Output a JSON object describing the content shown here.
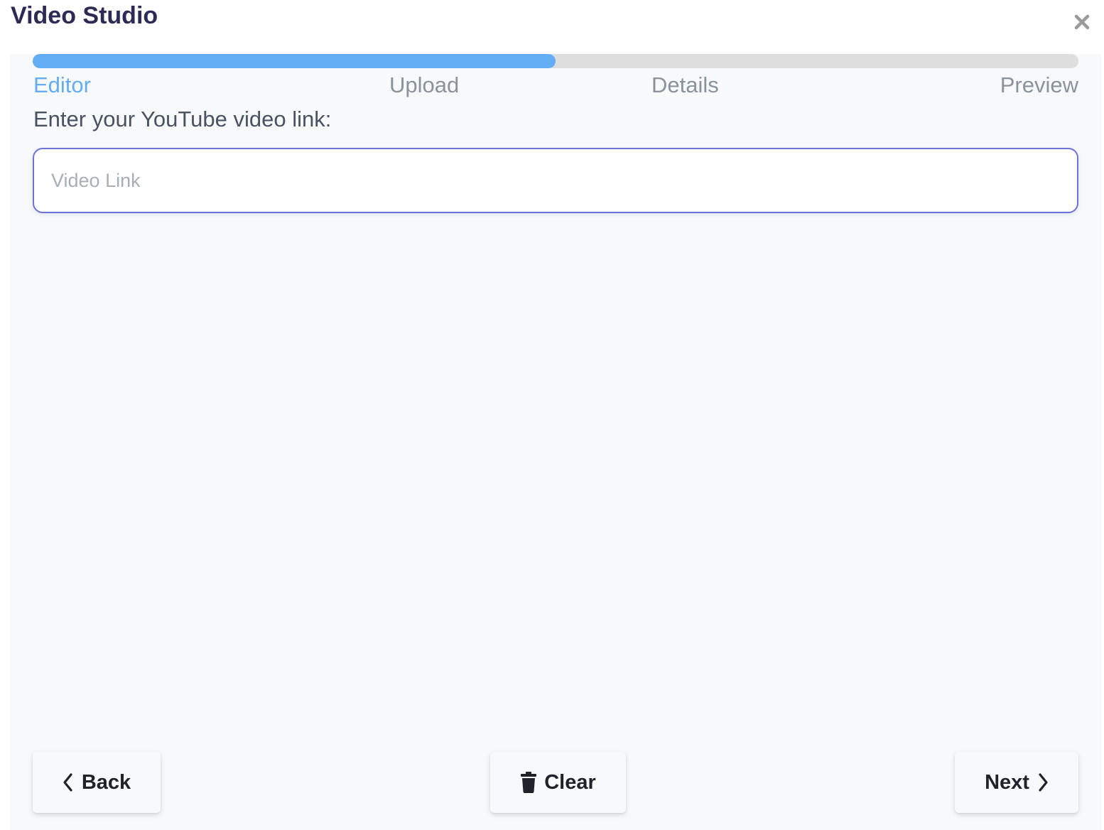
{
  "dialog": {
    "title": "Video Studio",
    "close_icon": "close-icon"
  },
  "progress": {
    "fraction": 0.5,
    "fill_color": "#64adf5",
    "track_color": "#dedede",
    "steps": [
      {
        "label": "Editor",
        "active": true
      },
      {
        "label": "Upload",
        "active": false
      },
      {
        "label": "Details",
        "active": false
      },
      {
        "label": "Preview",
        "active": false
      }
    ]
  },
  "form": {
    "label": "Enter your YouTube video link:",
    "input_value": "",
    "input_placeholder": "Video Link"
  },
  "footer": {
    "back_label": "Back",
    "back_icon": "chevron-left-icon",
    "clear_label": "Clear",
    "clear_icon": "trash-icon",
    "next_label": "Next",
    "next_icon": "chevron-right-icon"
  },
  "colors": {
    "accent": "#64adf5",
    "input_border": "#6d72d8",
    "title": "#2d2b55"
  }
}
